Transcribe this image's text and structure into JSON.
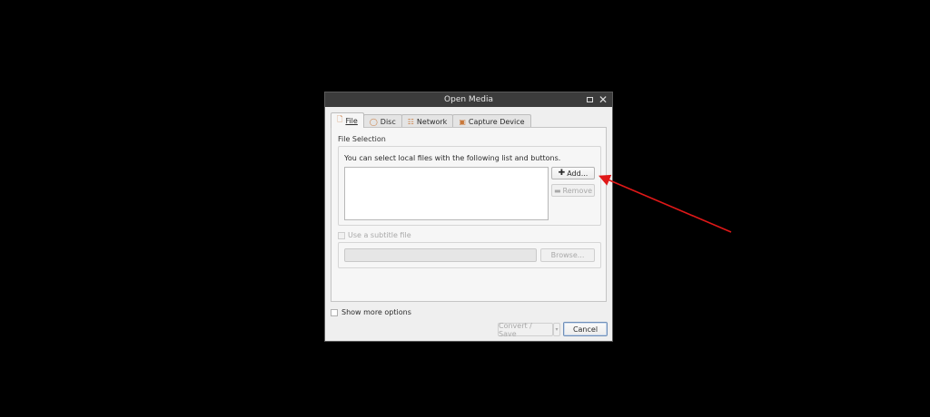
{
  "window": {
    "title": "Open Media",
    "maximize_icon": "maximize-icon",
    "close_glyph": "✕"
  },
  "tabs": [
    {
      "label": "File",
      "icon": "file-icon",
      "active": true
    },
    {
      "label": "Disc",
      "icon": "disc-icon",
      "active": false
    },
    {
      "label": "Network",
      "icon": "network-icon",
      "active": false
    },
    {
      "label": "Capture Device",
      "icon": "capture-device-icon",
      "active": false
    }
  ],
  "file_selection": {
    "group_label": "File Selection",
    "description": "You can select local files with the following list and buttons.",
    "add_label": "Add...",
    "remove_label": "Remove"
  },
  "subtitle": {
    "checkbox_label": "Use a subtitle file",
    "browse_label": "Browse..."
  },
  "footer": {
    "more_options_label": "Show more options",
    "convert_label": "Convert / Save",
    "cancel_label": "Cancel"
  },
  "colors": {
    "background": "#000000",
    "annotation_arrow": "#e01818"
  }
}
